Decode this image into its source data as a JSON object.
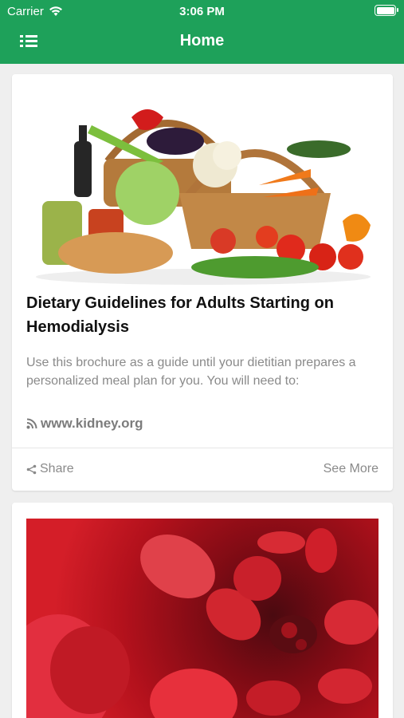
{
  "status_bar": {
    "carrier": "Carrier",
    "time": "3:06 PM"
  },
  "header": {
    "title": "Home",
    "background": "#1ea15a"
  },
  "articles": [
    {
      "title": "Dietary Guidelines for Adults Starting on Hemodialysis",
      "description": "Use this brochure as a guide until your dietitian prepares a personalized meal plan for you. You will need to:",
      "source": "www.kidney.org",
      "share_label": "Share",
      "see_more_label": "See More",
      "image": "vegetables-basket-photo"
    },
    {
      "image": "red-blood-cells-photo"
    }
  ],
  "icons": [
    "wifi-icon",
    "battery-icon",
    "menu-list-icon",
    "rss-icon",
    "share-icon"
  ]
}
